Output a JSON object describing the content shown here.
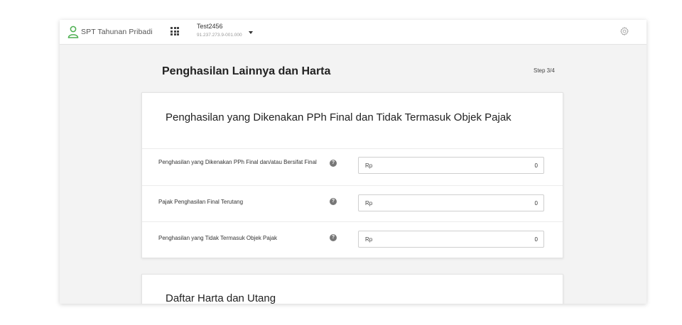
{
  "header": {
    "app_title": "SPT Tahunan Pribadi",
    "account_name": "Test2456",
    "account_npwp": "91.237.273.9-001.000"
  },
  "page": {
    "title": "Penghasilan Lainnya dan Harta",
    "step": "Step 3/4"
  },
  "section_final": {
    "title": "Penghasilan yang Dikenakan PPh Final dan Tidak Termasuk Objek Pajak",
    "rows": [
      {
        "label": "Penghasilan yang Dikenakan PPh Final dan/atau Bersifat Final",
        "currency": "Rp",
        "value": "0"
      },
      {
        "label": "Pajak Penghasilan Final Terutang",
        "currency": "Rp",
        "value": "0"
      },
      {
        "label": "Penghasilan yang Tidak Termasuk Objek Pajak",
        "currency": "Rp",
        "value": "0"
      }
    ]
  },
  "section_assets": {
    "title": "Daftar Harta dan Utang"
  },
  "help_glyph": "?",
  "icons": {
    "user": "user-icon",
    "apps": "apps-grid-icon",
    "dropdown": "caret-down-icon",
    "settings": "gear-icon",
    "help": "help-icon"
  },
  "colors": {
    "user_icon": "#4caf50",
    "help_badge": "#777777"
  }
}
